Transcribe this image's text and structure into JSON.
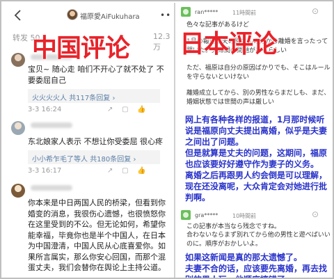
{
  "left": {
    "username": "福原愛AiFukuhara",
    "stats_left": "转发 50",
    "stats_right": "12.3万",
    "overlay_title": "中国评论",
    "comments": [
      {
        "text": "宝贝~ 随心走 咱们不开心了就不处了 不要委屈自己",
        "reply_user": "火火火火人",
        "reply_count": "共117条回复",
        "time": "3-3 16:24"
      },
      {
        "text": "东北娘家人表示 不想让你受委屈 很心疼",
        "reply_user": "小小希乍毛了等人",
        "reply_count": "共180条回复",
        "time": "3-3 16:17"
      },
      {
        "text": "你本来是中日两国人民的桥梁，但看到你婚变的消息，我很伤心遗憾，也很愤怒你在这里受到的不公。但无论如何，希望你能幸福，毕竟你也是半个中国人，在日本为中国澄清，中国人民从心底喜爱你。如果所言属实，那么你安心回国，而那个混蛋丈夫，我们会替你在舆论上主持公道。"
      }
    ]
  },
  "right": {
    "overlay_title": "日本评论",
    "comment1": {
      "user": "ran*****",
      "time": "11時間前",
      "jp": [
        "色々な記事があるけど",
        "1月の報道は夫の原さんの方から離婚を言ったって聞いた。夫婦間の問題があるらしい",
        "ただ、福原は自分の原因ばかりでも、そこはルールを守らないといけない",
        "離婚成立してから、別の男性ならまだしも、まだ、婚姻状態では世間の声は厳しい"
      ],
      "zh": [
        "网上有各种各样的报道，1月那时候听说是福原向丈夫提出离婚，似乎是夫妻之间出了问题。",
        "但是就算是丈夫的问题，这期间，福原也应该要好好遵守作为妻子的义务。",
        "离婚之后再跟男人约会倒是可以理解，现在还没离呢，大众肯定会对她进行批判啊。"
      ]
    },
    "comment2": {
      "user": "gra*****",
      "time": "10時間前",
      "jp": [
        "この記事が本当なら残念ですね。",
        "合わないならまず別れてから他の男性と遊べばいいのに。順序がおかしいよ。"
      ],
      "zh": [
        "如果这新闻是真的那太遗憾了。",
        "夫妻不合的话，应该要先离婚，再去找别的男人玩。他顺序搞错了。"
      ]
    }
  },
  "colors": {
    "title_red": "#e8232a",
    "zh_blue": "#2a33c9",
    "link_blue": "#5b7fa8"
  }
}
